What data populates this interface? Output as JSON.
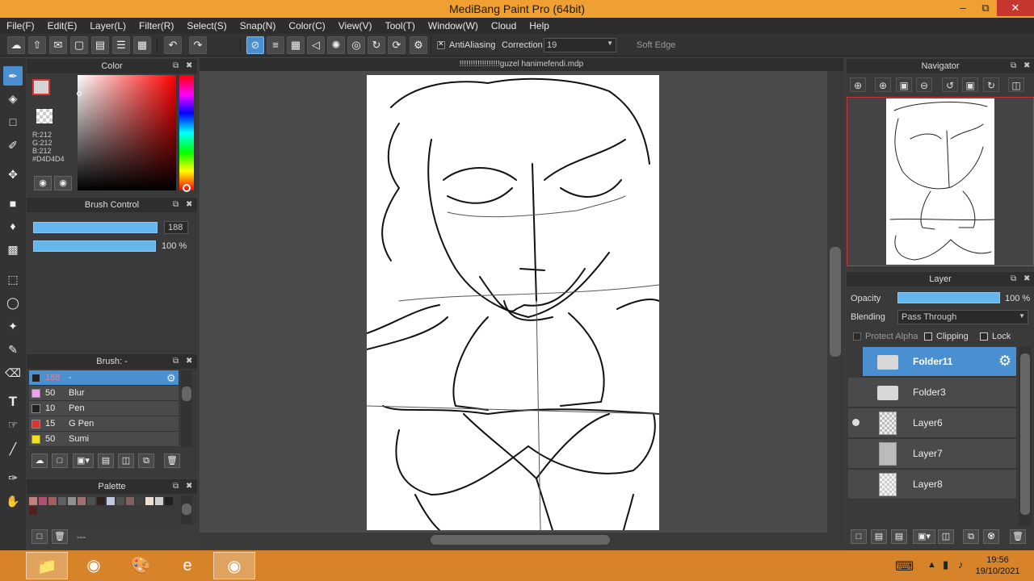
{
  "window": {
    "title": "MediBang Paint Pro (64bit)"
  },
  "menu": [
    "File(F)",
    "Edit(E)",
    "Layer(L)",
    "Filter(R)",
    "Select(S)",
    "Snap(N)",
    "Color(C)",
    "View(V)",
    "Tool(T)",
    "Window(W)",
    "Cloud",
    "Help"
  ],
  "toolbar": {
    "antialias_label": "AntiAliasing",
    "correction_label": "Correction",
    "correction_value": "19",
    "soft_edge_label": "Soft Edge"
  },
  "color_panel": {
    "title": "Color",
    "r": "R:212",
    "g": "G:212",
    "b": "B:212",
    "hex": "#D4D4D4",
    "fg_color": "#d4d4d4",
    "accent": "#e03030"
  },
  "brush_control": {
    "title": "Brush Control",
    "size_value": "188",
    "opacity_value": "100 %"
  },
  "brush_list": {
    "title": "Brush: -",
    "items": [
      {
        "size": "188",
        "name": "-",
        "color": "#222222"
      },
      {
        "size": "50",
        "name": "Blur",
        "color": "#f0a0f0"
      },
      {
        "size": "10",
        "name": "Pen",
        "color": "#222222"
      },
      {
        "size": "15",
        "name": "G Pen",
        "color": "#e03030"
      },
      {
        "size": "50",
        "name": "Sumi",
        "color": "#f0e020"
      }
    ]
  },
  "palette": {
    "title": "Palette",
    "footer_label": "---",
    "colors": [
      "#c08080",
      "#b05070",
      "#a06060",
      "#606060",
      "#909090",
      "#a07070",
      "#505050",
      "#302020",
      "#c0c8e0",
      "#505050",
      "#806060",
      "#404040",
      "#302020",
      "#f0e0d0",
      "#d0d0d0",
      "#202020",
      "#502020"
    ]
  },
  "document": {
    "tab_title": "!!!!!!!!!!!!!!!!!!guzel hanimefendi.mdp"
  },
  "navigator": {
    "title": "Navigator"
  },
  "layer_panel": {
    "title": "Layer",
    "opacity_label": "Opacity",
    "opacity_value": "100 %",
    "blending_label": "Blending",
    "blending_value": "Pass Through",
    "protect_alpha_label": "Protect Alpha",
    "clipping_label": "Clipping",
    "lock_label": "Lock",
    "layers": [
      {
        "name": "Folder11",
        "type": "folder",
        "selected": true
      },
      {
        "name": "Folder3",
        "type": "folder",
        "selected": false
      },
      {
        "name": "Layer6",
        "type": "layer",
        "selected": false
      },
      {
        "name": "Layer7",
        "type": "layer",
        "selected": false
      },
      {
        "name": "Layer8",
        "type": "layer",
        "selected": false
      }
    ]
  },
  "taskbar": {
    "time": "19:56",
    "date": "19/10/2021"
  }
}
